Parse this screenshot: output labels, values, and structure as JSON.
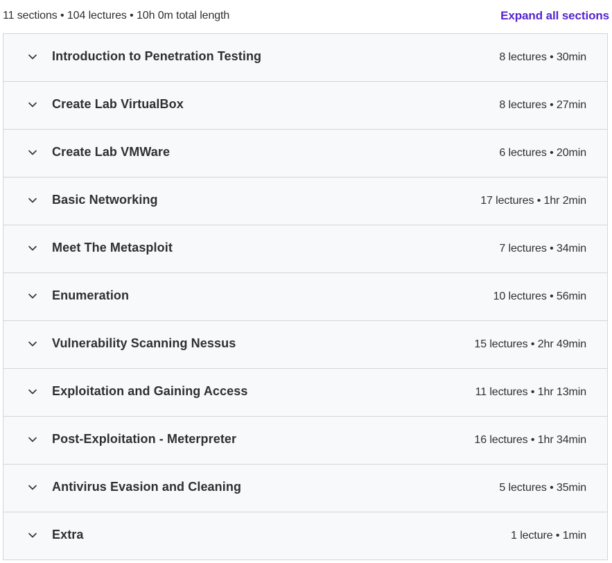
{
  "summary": {
    "text": "11 sections • 104 lectures • 10h 0m total length",
    "expand_label": "Expand all sections"
  },
  "colors": {
    "accent": "#5624d0",
    "row_background": "#f7f9fa",
    "border": "#d1d7dc",
    "text": "#2d2f31"
  },
  "sections": [
    {
      "title": "Introduction to Penetration Testing",
      "meta": "8 lectures • 30min",
      "icon": "chevron-down-icon"
    },
    {
      "title": "Create Lab VirtualBox",
      "meta": "8 lectures • 27min",
      "icon": "chevron-down-icon"
    },
    {
      "title": "Create Lab VMWare",
      "meta": "6 lectures • 20min",
      "icon": "chevron-down-icon"
    },
    {
      "title": "Basic Networking",
      "meta": "17 lectures • 1hr 2min",
      "icon": "chevron-down-icon"
    },
    {
      "title": "Meet The Metasploit",
      "meta": "7 lectures • 34min",
      "icon": "chevron-down-icon"
    },
    {
      "title": "Enumeration",
      "meta": "10 lectures • 56min",
      "icon": "chevron-down-icon"
    },
    {
      "title": "Vulnerability Scanning Nessus",
      "meta": "15 lectures • 2hr 49min",
      "icon": "chevron-down-icon"
    },
    {
      "title": "Exploitation and Gaining Access",
      "meta": "11 lectures • 1hr 13min",
      "icon": "chevron-down-icon"
    },
    {
      "title": "Post-Exploitation - Meterpreter",
      "meta": "16 lectures • 1hr 34min",
      "icon": "chevron-down-icon"
    },
    {
      "title": "Antivirus Evasion and Cleaning",
      "meta": "5 lectures • 35min",
      "icon": "chevron-down-icon"
    },
    {
      "title": "Extra",
      "meta": "1 lecture • 1min",
      "icon": "chevron-down-icon"
    }
  ]
}
